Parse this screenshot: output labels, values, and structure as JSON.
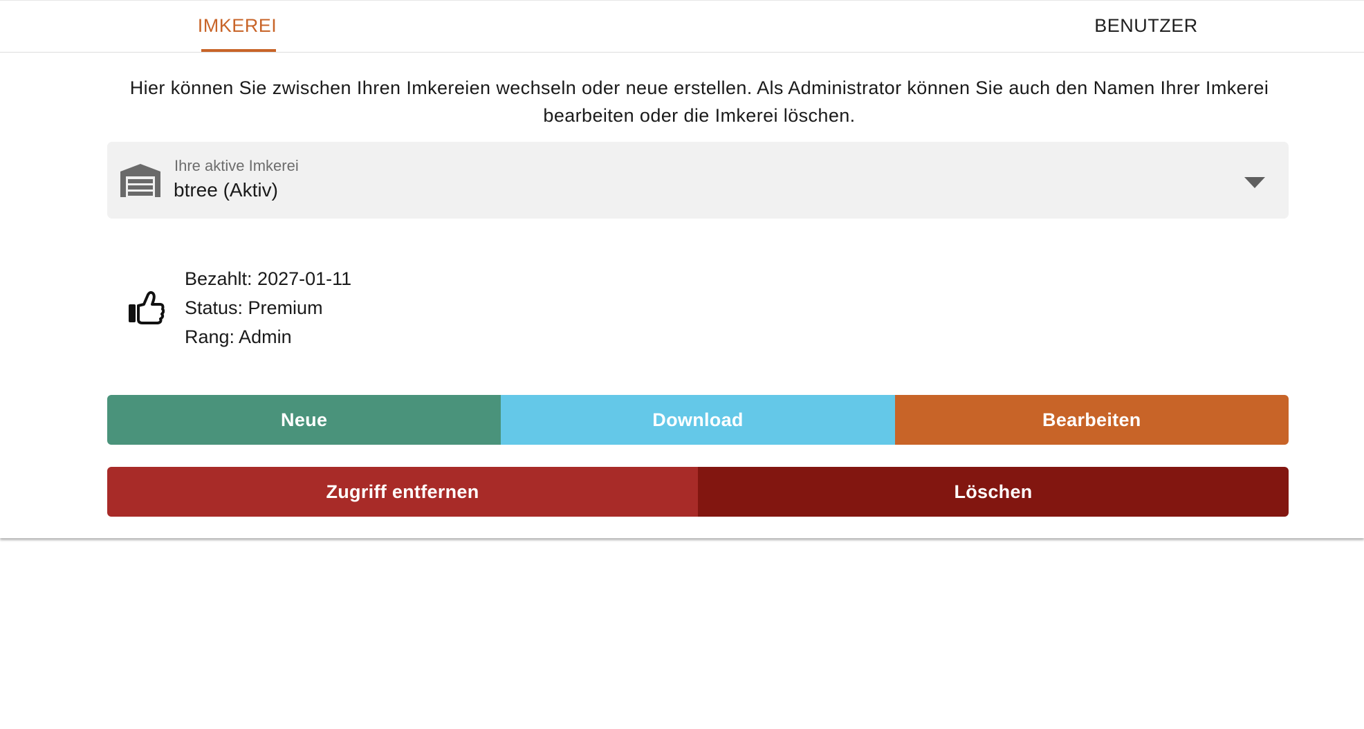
{
  "tabs": [
    {
      "label": "IMKEREI",
      "active": true
    },
    {
      "label": "BENUTZER",
      "active": false
    }
  ],
  "intro_text": "Hier können Sie zwischen Ihren Imkereien wechseln oder neue erstellen. Als Administrator können Sie auch den Namen Ihrer Imkerei bearbeiten oder die Imkerei löschen.",
  "apiary_select": {
    "label": "Ihre aktive Imkerei",
    "value": "btree (Aktiv)",
    "icon": "warehouse-icon"
  },
  "info": {
    "icon": "thumbs-up-icon",
    "paid": "Bezahlt: 2027-01-11",
    "status": "Status: Premium",
    "rank": "Rang: Admin"
  },
  "buttons": {
    "new": {
      "label": "Neue",
      "color": "#4a937b"
    },
    "download": {
      "label": "Download",
      "color": "#64c8e8"
    },
    "edit": {
      "label": "Bearbeiten",
      "color": "#c86428"
    },
    "remove_access": {
      "label": "Zugriff entfernen",
      "color": "#a82b28"
    },
    "delete": {
      "label": "Löschen",
      "color": "#821610"
    }
  },
  "colors": {
    "accent": "#c86428"
  }
}
